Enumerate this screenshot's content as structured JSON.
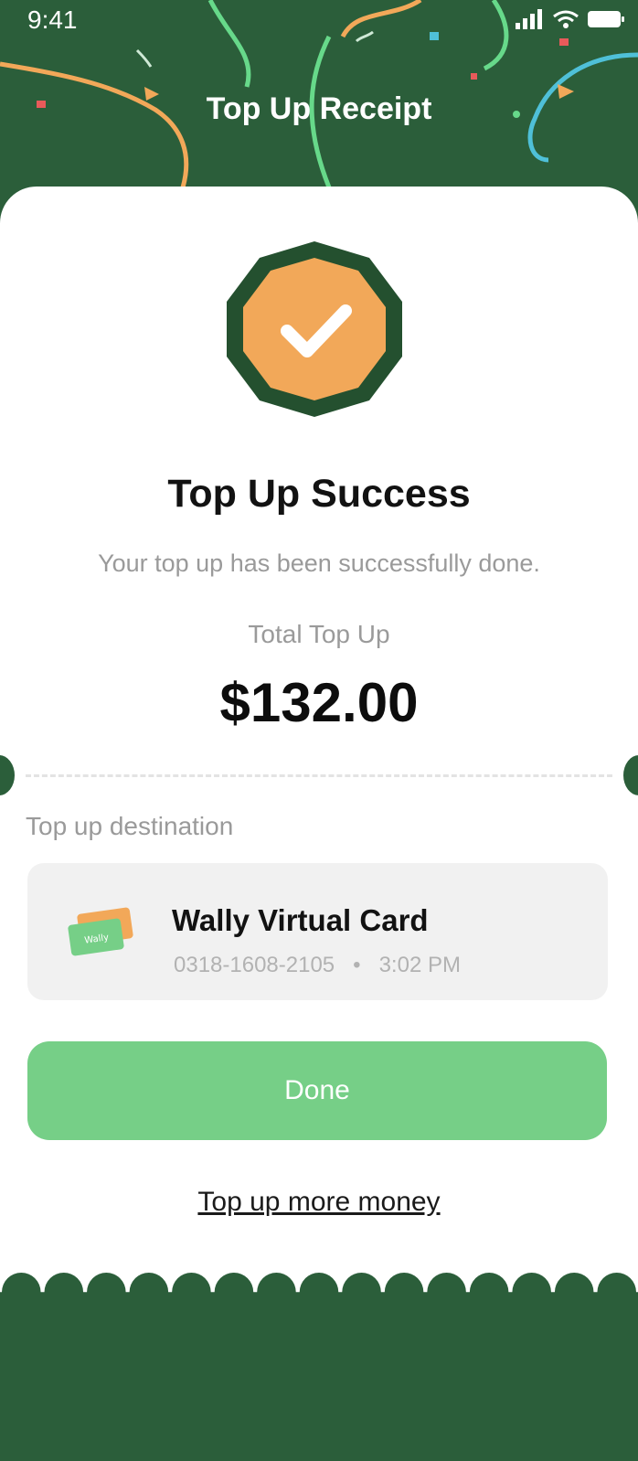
{
  "status_bar": {
    "time": "9:41"
  },
  "header": {
    "title": "Top Up Receipt"
  },
  "result": {
    "title": "Top Up Success",
    "subtitle": "Your top up has been successfully done.",
    "total_label": "Total Top Up",
    "total_amount": "$132.00"
  },
  "destination": {
    "label": "Top up destination",
    "card_name": "Wally Virtual Card",
    "card_number": "0318-1608-2105",
    "time": "3:02 PM",
    "thumb_text": "Wally"
  },
  "actions": {
    "done_label": "Done",
    "more_label": "Top up more money"
  },
  "colors": {
    "header_bg": "#2b5e3a",
    "badge_outer": "#24502f",
    "badge_inner": "#f2a859",
    "button_bg": "#76cf87"
  }
}
